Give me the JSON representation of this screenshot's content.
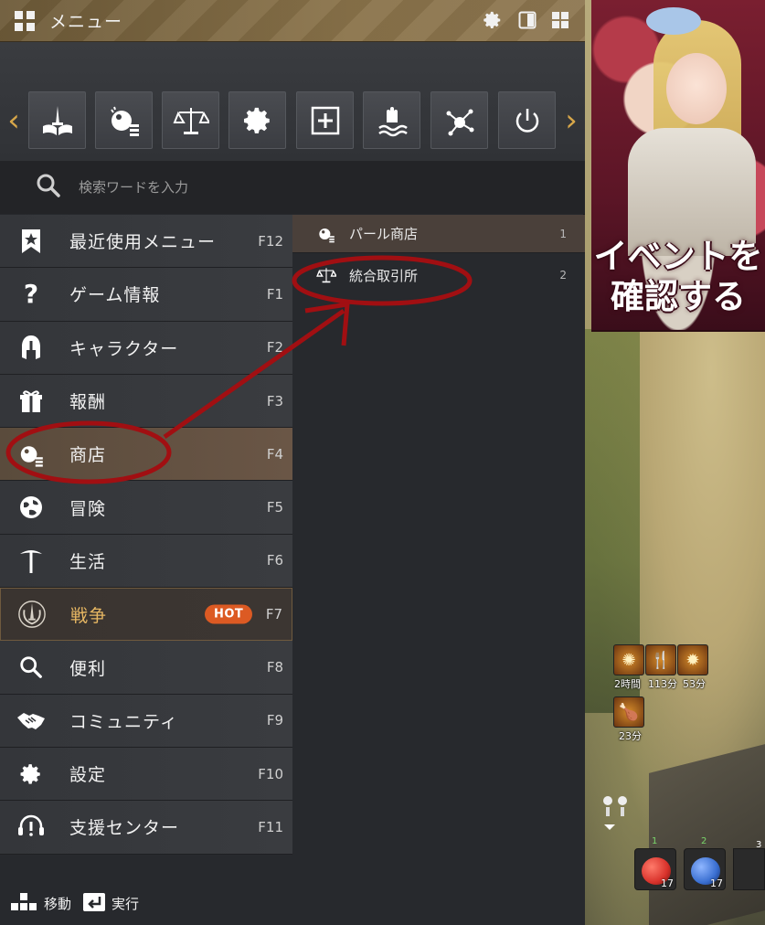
{
  "menu": {
    "title": "メニュー",
    "search_placeholder": "検索ワードを入力",
    "quick_buttons": [
      {
        "icon": "book-sword-icon"
      },
      {
        "icon": "pearl-shop-icon"
      },
      {
        "icon": "scales-icon"
      },
      {
        "icon": "gear-icon"
      },
      {
        "icon": "plus-box-icon"
      },
      {
        "icon": "hand-water-icon"
      },
      {
        "icon": "network-icon"
      },
      {
        "icon": "power-icon"
      }
    ],
    "categories": [
      {
        "label": "最近使用メニュー",
        "key": "F12",
        "icon": "bookmark-star-icon"
      },
      {
        "label": "ゲーム情報",
        "key": "F1",
        "icon": "question-icon"
      },
      {
        "label": "キャラクター",
        "key": "F2",
        "icon": "helmet-icon"
      },
      {
        "label": "報酬",
        "key": "F3",
        "icon": "gift-icon"
      },
      {
        "label": "商店",
        "key": "F4",
        "icon": "shop-icon"
      },
      {
        "label": "冒険",
        "key": "F5",
        "icon": "globe-icon"
      },
      {
        "label": "生活",
        "key": "F6",
        "icon": "pickaxe-icon"
      },
      {
        "label": "戦争",
        "key": "F7",
        "icon": "war-emblem-icon",
        "badge": "HOT"
      },
      {
        "label": "便利",
        "key": "F8",
        "icon": "magnifier-icon"
      },
      {
        "label": "コミュニティ",
        "key": "F9",
        "icon": "handshake-icon"
      },
      {
        "label": "設定",
        "key": "F10",
        "icon": "gear-icon"
      },
      {
        "label": "支援センター",
        "key": "F11",
        "icon": "headset-icon"
      }
    ],
    "submenu": [
      {
        "label": "パール商店",
        "num": "1",
        "icon": "pearl-shop-icon"
      },
      {
        "label": "統合取引所",
        "num": "2",
        "icon": "scales-icon"
      }
    ],
    "footer": {
      "move": "移動",
      "execute": "実行"
    }
  },
  "event_banner": {
    "text": "イベントを\n確認する"
  },
  "hud": {
    "buffs": [
      "2時間",
      "113分",
      "53分",
      "23分"
    ],
    "potions": [
      {
        "slot": "1",
        "count": "17",
        "color": "#d8322b"
      },
      {
        "slot": "2",
        "count": "17",
        "color": "#3a6fd1"
      }
    ],
    "slot3": "3"
  },
  "colors": {
    "accent": "#d7a74a",
    "annotation": "#a10f12",
    "hot": "#dc5a23"
  }
}
